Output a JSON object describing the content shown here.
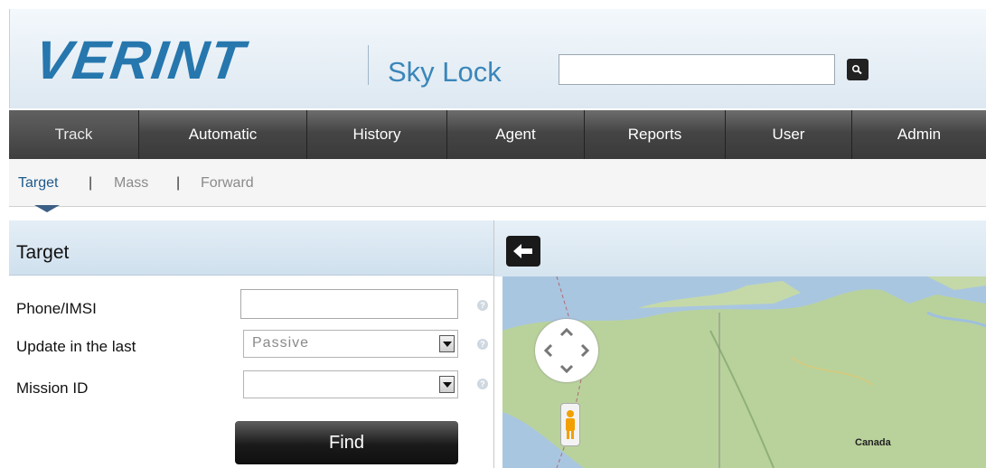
{
  "header": {
    "logo": "VERINT",
    "product": "Sky Lock",
    "search": {
      "value": "",
      "placeholder": ""
    },
    "search_icon": "search-icon"
  },
  "nav": {
    "items": [
      {
        "label": "Track",
        "active": true
      },
      {
        "label": "Automatic",
        "active": false
      },
      {
        "label": "History",
        "active": false
      },
      {
        "label": "Agent",
        "active": false
      },
      {
        "label": "Reports",
        "active": false
      },
      {
        "label": "User",
        "active": false
      },
      {
        "label": "Admin",
        "active": false
      }
    ]
  },
  "subnav": {
    "items": [
      "Target",
      "Mass",
      "Forward"
    ],
    "separator": "|",
    "active": "Target"
  },
  "panel": {
    "title": "Target",
    "fields": {
      "phone_label": "Phone/IMSI",
      "phone_value": "",
      "update_label": "Update in the last",
      "update_value": "Passive",
      "mission_label": "Mission ID",
      "mission_value": ""
    },
    "help_glyph": "?",
    "find_label": "Find"
  },
  "map": {
    "back_icon": "arrow-left-icon",
    "label": "Canada"
  },
  "colors": {
    "brand": "#2677ad",
    "nav_bg": "#454545",
    "header_bg": "#e6eff6"
  }
}
